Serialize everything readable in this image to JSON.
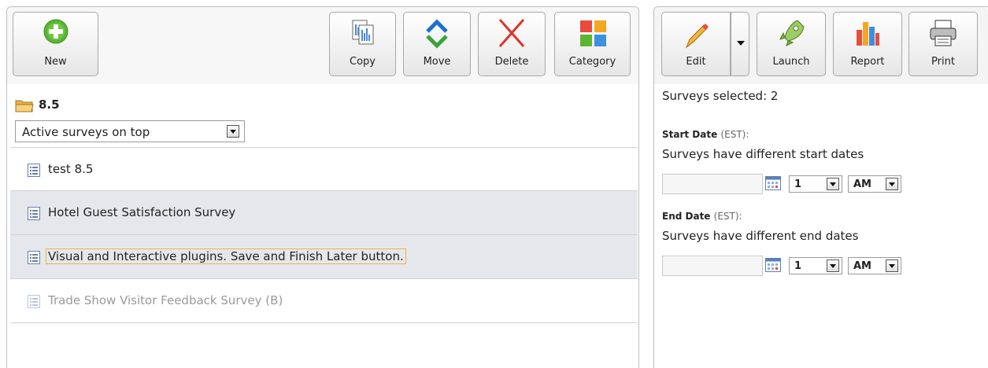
{
  "toolbar_left": {
    "new_label": "New",
    "copy_label": "Copy",
    "move_label": "Move",
    "delete_label": "Delete",
    "category_label": "Category"
  },
  "folder": {
    "name": "8.5"
  },
  "sort": {
    "selected": "Active surveys on top"
  },
  "surveys": [
    {
      "title": "test 8.5"
    },
    {
      "title": "Hotel Guest Satisfaction Survey"
    },
    {
      "title": "Visual and Interactive plugins. Save and Finish Later button."
    },
    {
      "title": "Trade Show Visitor Feedback Survey (B)"
    }
  ],
  "toolbar_right": {
    "edit_label": "Edit",
    "launch_label": "Launch",
    "report_label": "Report",
    "print_label": "Print"
  },
  "details": {
    "selected_text": "Surveys selected: 2",
    "start_heading": "Start Date",
    "start_zone": "(EST):",
    "start_note": "Surveys have different start dates",
    "start_hour": "1",
    "start_ampm": "AM",
    "end_heading": "End Date",
    "end_zone": "(EST):",
    "end_note": "Surveys have different end dates",
    "end_hour": "1",
    "end_ampm": "AM"
  },
  "colors": {
    "selected_row": "#e5e7ec",
    "focus_outline": "#f0b442",
    "new_icon": "#5cb531",
    "move_blue": "#1b6fd1",
    "move_green": "#3aa33a",
    "delete_red": "#e0322b"
  }
}
